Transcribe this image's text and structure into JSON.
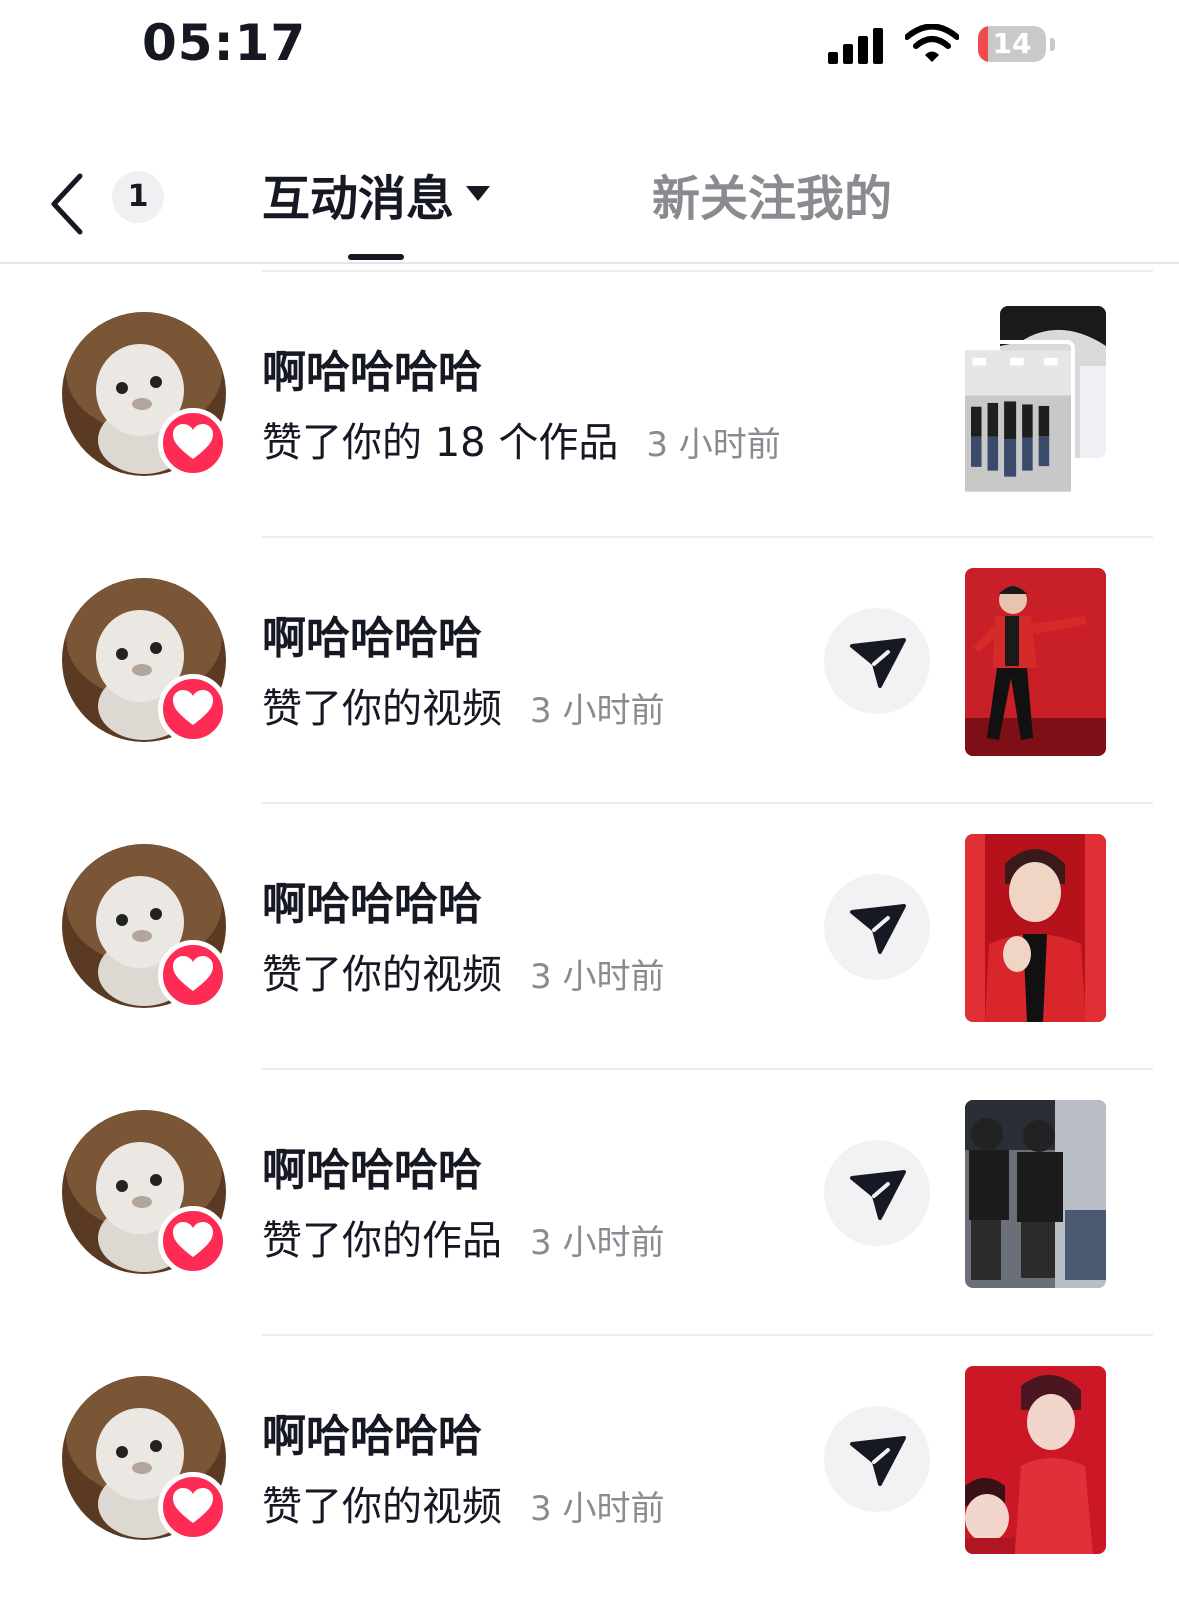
{
  "status_bar": {
    "time": "05:17",
    "battery_level": "14",
    "battery_fraction": 0.14,
    "icons": [
      "signal-icon",
      "wifi-icon",
      "battery-icon"
    ]
  },
  "header": {
    "back_icon": "chevron-left-icon",
    "unread_count": "1",
    "tabs": [
      {
        "label": "互动消息",
        "active": true,
        "has_dropdown": true
      },
      {
        "label": "新关注我的",
        "active": false
      }
    ]
  },
  "notifications": [
    {
      "user": "啊哈哈哈哈",
      "action": "赞了你的 18 个作品",
      "time": "3 小时前",
      "share_button": false,
      "thumbnail": "stacked-dance-practice"
    },
    {
      "user": "啊哈哈哈哈",
      "action": "赞了你的视频",
      "time": "3 小时前",
      "share_button": true,
      "thumbnail": "red-stage-performance"
    },
    {
      "user": "啊哈哈哈哈",
      "action": "赞了你的视频",
      "time": "3 小时前",
      "share_button": true,
      "thumbnail": "red-stage-closeup"
    },
    {
      "user": "啊哈哈哈哈",
      "action": "赞了你的作品",
      "time": "3 小时前",
      "share_button": true,
      "thumbnail": "seated-group"
    },
    {
      "user": "啊哈哈哈哈",
      "action": "赞了你的视频",
      "time": "3 小时前",
      "share_button": true,
      "thumbnail": "red-stage-duo"
    }
  ],
  "colors": {
    "like_red": "#fe2c55",
    "text_primary": "#161823",
    "text_secondary": "#8a8b91",
    "battery_red": "#f04a4a"
  }
}
